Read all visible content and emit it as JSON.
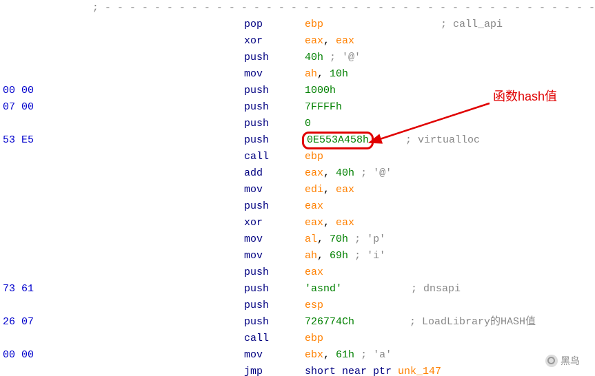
{
  "hex": {
    "r4": "00 00",
    "r5": "07 00",
    "r7": "53 E5",
    "r16": "73 61",
    "r18": "26 07",
    "r20": "00 00"
  },
  "sep": {
    "semi": ";",
    "dashes": " - - - - - - - - - - - - - - - - - - - - - - - - - - - - - - - - - - - - - - - -"
  },
  "rows": [
    {
      "op": "pop",
      "arg": {
        "t": "reg",
        "v": "ebp"
      },
      "cmt": "; call_api",
      "cmtpad": 170
    },
    {
      "op": "xor",
      "arg": {
        "t": "reg2",
        "a": "eax",
        "b": "eax"
      }
    },
    {
      "op": "push",
      "arg": {
        "t": "numc",
        "v": "40h",
        "c": "; '@'"
      }
    },
    {
      "op": "mov",
      "arg": {
        "t": "regnum",
        "r": "ah",
        "n": "10h"
      }
    },
    {
      "op": "push",
      "arg": {
        "t": "num",
        "v": "1000h"
      }
    },
    {
      "op": "push",
      "arg": {
        "t": "num",
        "v": "7FFFFh"
      }
    },
    {
      "op": "push",
      "arg": {
        "t": "num",
        "v": "0"
      }
    },
    {
      "op": "push",
      "arg": {
        "t": "highlight",
        "v": "0E553A458h"
      },
      "cmt": "; virtualloc",
      "cmtpad": 50
    },
    {
      "op": "call",
      "arg": {
        "t": "reg",
        "v": "ebp"
      }
    },
    {
      "op": "add",
      "arg": {
        "t": "regnumc",
        "r": "eax",
        "n": "40h",
        "c": "; '@'"
      }
    },
    {
      "op": "mov",
      "arg": {
        "t": "reg2",
        "a": "edi",
        "b": "eax"
      }
    },
    {
      "op": "push",
      "arg": {
        "t": "reg",
        "v": "eax"
      }
    },
    {
      "op": "xor",
      "arg": {
        "t": "reg2",
        "a": "eax",
        "b": "eax"
      }
    },
    {
      "op": "mov",
      "arg": {
        "t": "regnumc",
        "r": "al",
        "n": "70h",
        "c": "; 'p'"
      }
    },
    {
      "op": "mov",
      "arg": {
        "t": "regnumc",
        "r": "ah",
        "n": "69h",
        "c": "; 'i'"
      }
    },
    {
      "op": "push",
      "arg": {
        "t": "reg",
        "v": "eax"
      }
    },
    {
      "op": "push",
      "arg": {
        "t": "str",
        "v": "'asnd'"
      },
      "cmt": "; dnsapi",
      "cmtpad": 100
    },
    {
      "op": "push",
      "arg": {
        "t": "reg",
        "v": "esp"
      }
    },
    {
      "op": "push",
      "arg": {
        "t": "num",
        "v": "726774Ch"
      },
      "cmt": "; LoadLibrary的HASH值",
      "cmtpad": 80
    },
    {
      "op": "call",
      "arg": {
        "t": "reg",
        "v": "ebp"
      }
    },
    {
      "op": "mov",
      "arg": {
        "t": "regnumc",
        "r": "ebx",
        "n": "61h",
        "c": "; 'a'"
      }
    },
    {
      "op": "jmp",
      "arg": {
        "t": "jmp",
        "v": "short near ptr unk_147"
      }
    }
  ],
  "annotation": "函数hash值",
  "watermark": "黑鸟"
}
